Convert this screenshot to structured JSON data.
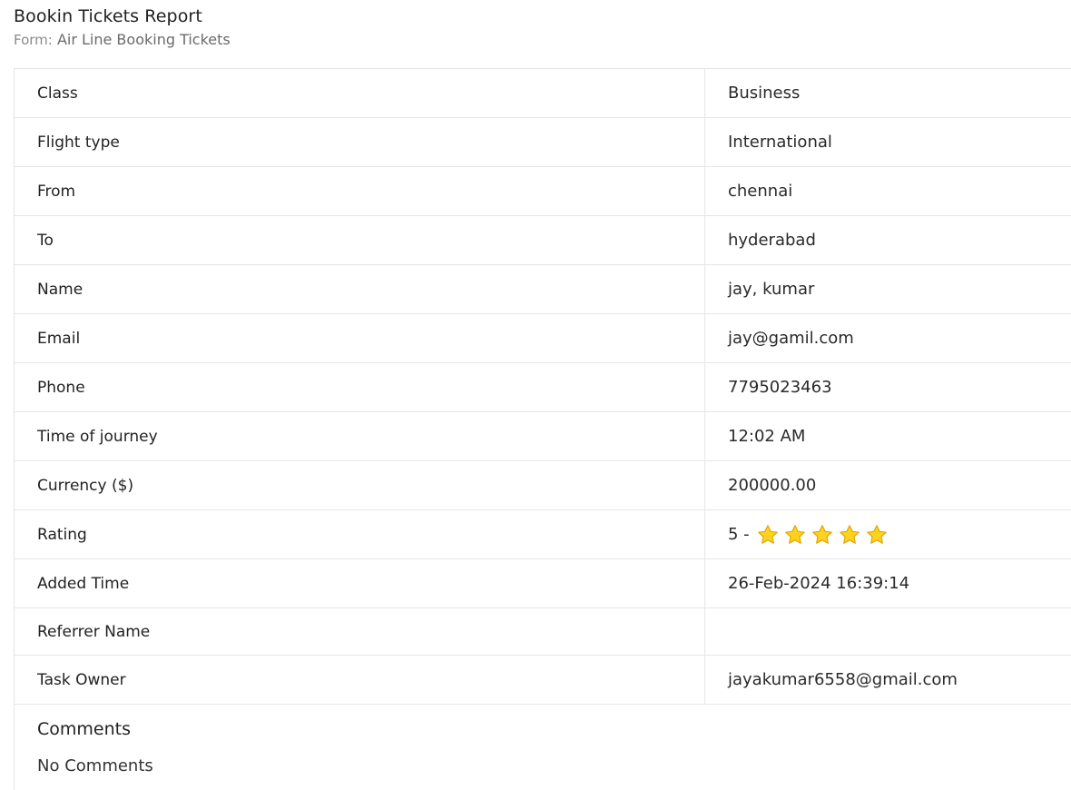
{
  "report": {
    "title": "Bookin Tickets Report",
    "form_prefix": "Form:",
    "form_name": "Air Line Booking Tickets"
  },
  "fields": [
    {
      "label": "Class",
      "value": "Business"
    },
    {
      "label": "Flight type",
      "value": "International"
    },
    {
      "label": "From",
      "value": "chennai"
    },
    {
      "label": "To",
      "value": "hyderabad"
    },
    {
      "label": "Name",
      "value": "jay, kumar"
    },
    {
      "label": "Email",
      "value": "jay@gamil.com"
    },
    {
      "label": "Phone",
      "value": "7795023463"
    },
    {
      "label": "Time of journey",
      "value": "12:02 AM"
    },
    {
      "label": "Currency ($)",
      "value": "200000.00"
    },
    {
      "label": "Rating",
      "value": "5 -",
      "stars": 5
    },
    {
      "label": "Added Time",
      "value": "26-Feb-2024 16:39:14"
    },
    {
      "label": "Referrer Name",
      "value": ""
    },
    {
      "label": "Task Owner",
      "value": "jayakumar6558@gmail.com"
    }
  ],
  "comments": {
    "title": "Comments",
    "text": "No Comments"
  },
  "colors": {
    "star_fill": "#FFD21F",
    "star_stroke": "#E0A800"
  }
}
